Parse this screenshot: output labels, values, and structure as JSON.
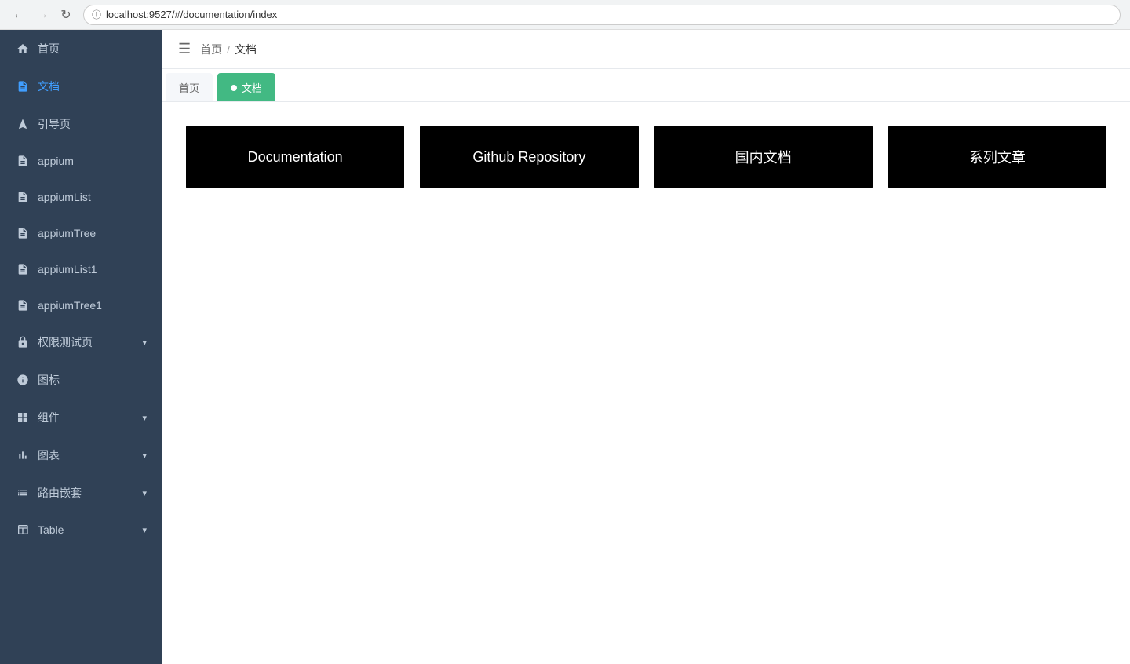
{
  "browser": {
    "url": "localhost:9527/#/documentation/index",
    "back_disabled": false,
    "forward_disabled": true
  },
  "sidebar": {
    "items": [
      {
        "id": "home",
        "label": "首页",
        "icon": "home",
        "active": false,
        "hasChevron": false
      },
      {
        "id": "docs",
        "label": "文档",
        "icon": "document",
        "active": true,
        "hasChevron": false
      },
      {
        "id": "guide",
        "label": "引导页",
        "icon": "guide",
        "active": false,
        "hasChevron": false
      },
      {
        "id": "appium",
        "label": "appium",
        "icon": "document",
        "active": false,
        "hasChevron": false
      },
      {
        "id": "appiumList",
        "label": "appiumList",
        "icon": "document",
        "active": false,
        "hasChevron": false
      },
      {
        "id": "appiumTree",
        "label": "appiumTree",
        "icon": "document",
        "active": false,
        "hasChevron": false
      },
      {
        "id": "appiumList1",
        "label": "appiumList1",
        "icon": "document",
        "active": false,
        "hasChevron": false
      },
      {
        "id": "appiumTree1",
        "label": "appiumTree1",
        "icon": "document",
        "active": false,
        "hasChevron": false
      },
      {
        "id": "permission",
        "label": "权限测试页",
        "icon": "lock",
        "active": false,
        "hasChevron": true
      },
      {
        "id": "icons",
        "label": "图标",
        "icon": "info",
        "active": false,
        "hasChevron": false
      },
      {
        "id": "components",
        "label": "组件",
        "icon": "grid",
        "active": false,
        "hasChevron": true
      },
      {
        "id": "charts",
        "label": "图表",
        "icon": "bar-chart",
        "active": false,
        "hasChevron": true
      },
      {
        "id": "router-nest",
        "label": "路由嵌套",
        "icon": "list",
        "active": false,
        "hasChevron": true
      },
      {
        "id": "table",
        "label": "Table",
        "icon": "table",
        "active": false,
        "hasChevron": true
      }
    ]
  },
  "header": {
    "breadcrumb": {
      "home": "首页",
      "separator": "/",
      "current": "文档"
    }
  },
  "tabs": [
    {
      "id": "home-tab",
      "label": "首页",
      "active": false,
      "hasDot": false
    },
    {
      "id": "docs-tab",
      "label": "文档",
      "active": true,
      "hasDot": true
    }
  ],
  "cards": [
    {
      "id": "documentation",
      "label": "Documentation"
    },
    {
      "id": "github",
      "label": "Github Repository"
    },
    {
      "id": "cn-docs",
      "label": "国内文档"
    },
    {
      "id": "series",
      "label": "系列文章"
    }
  ]
}
